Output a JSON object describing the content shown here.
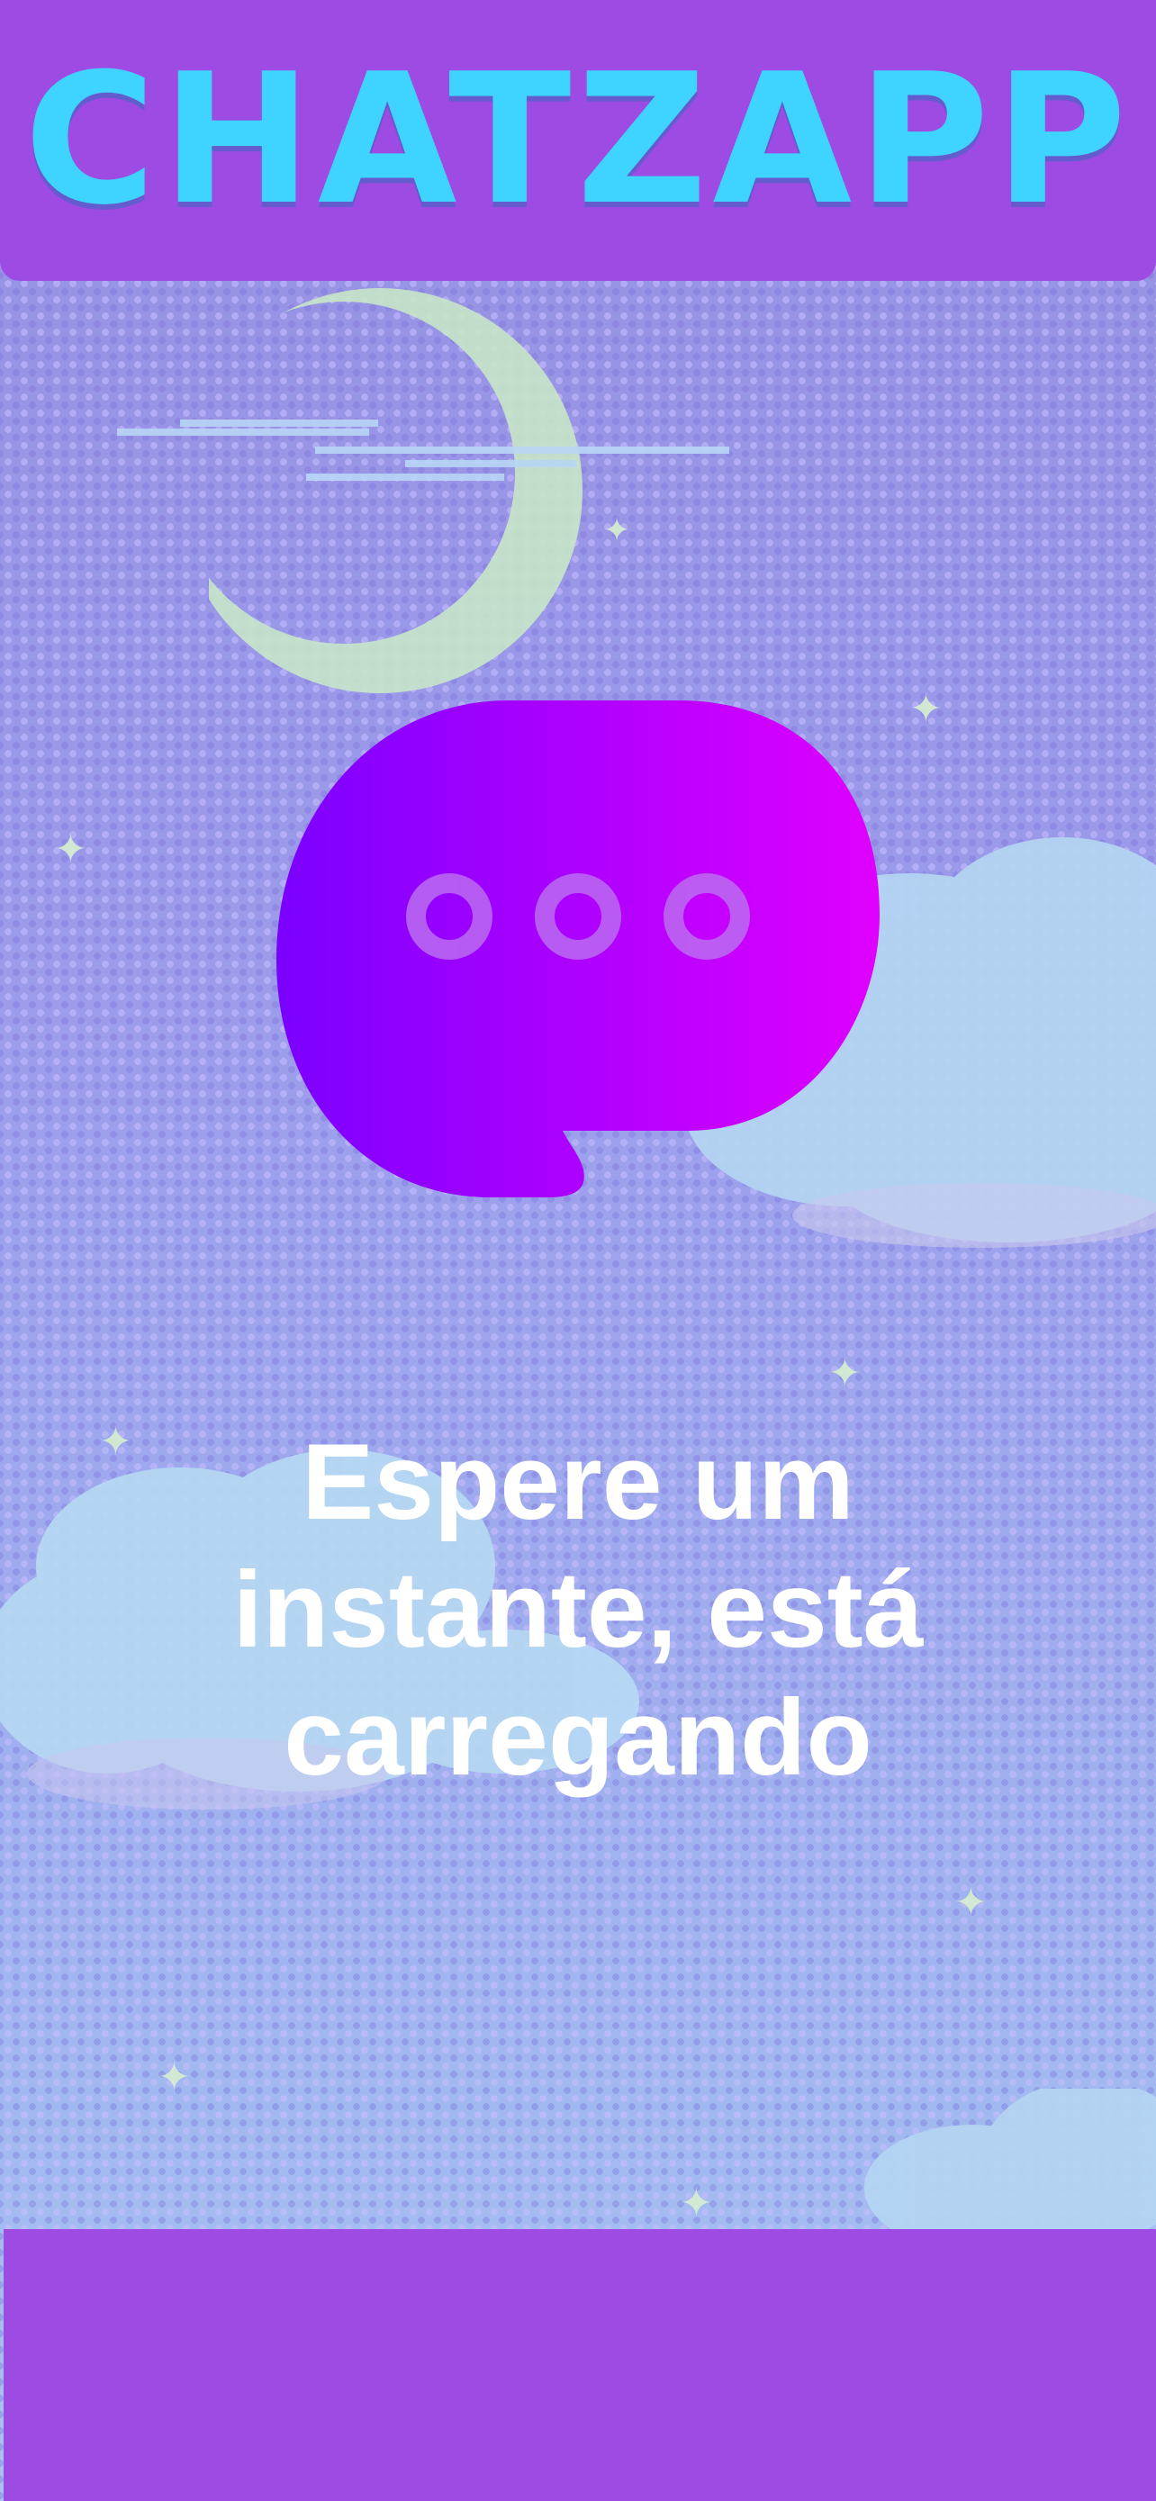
{
  "app": {
    "logo_text": "CHATZAPP",
    "logo_color": "#3fd4ff",
    "header_color": "#9d4be3"
  },
  "loading": {
    "message": "Espere um instante, está carregando",
    "icon": "chat-bubble-typing-icon"
  },
  "decorations": {
    "moon_icon": "crescent-moon-icon",
    "cloud_icon": "cloud-icon",
    "star_icon": "sparkle-star-icon"
  }
}
